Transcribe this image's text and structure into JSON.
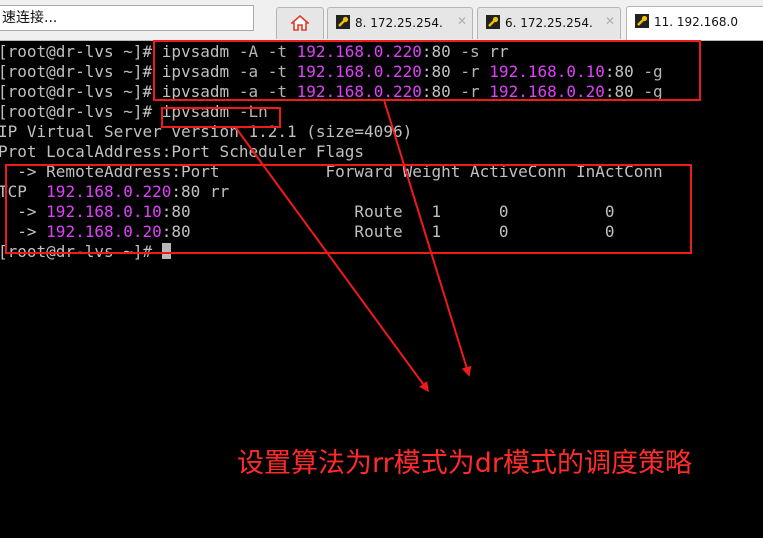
{
  "toolbar": {
    "quick_connect_text": "速连接..."
  },
  "tabs": [
    {
      "label": "",
      "icon": "home-icon",
      "active": false
    },
    {
      "label": "8. 172.25.254.",
      "icon": "tool-icon",
      "active": false
    },
    {
      "label": "6. 172.25.254.",
      "icon": "tool-icon",
      "active": false
    },
    {
      "label": "11. 192.168.0",
      "icon": "tool-icon",
      "active": true
    }
  ],
  "terminal": {
    "prompt": "[root@dr-lvs ~]#",
    "lines": [
      {
        "prompt": "[root@dr-lvs ~]#",
        "parts": [
          " ipvsadm ",
          "-A -t ",
          "192.168.0.220",
          ":80 ",
          "-s",
          " rr"
        ]
      },
      {
        "prompt": "[root@dr-lvs ~]#",
        "parts": [
          " ipvsadm ",
          "-a -t ",
          "192.168.0.220",
          ":80 ",
          "-r ",
          "192.168.0.10",
          ":80 ",
          "-g"
        ]
      },
      {
        "prompt": "[root@dr-lvs ~]#",
        "parts": [
          " ipvsadm ",
          "-a -t ",
          "192.168.0.220",
          ":80 ",
          "-r ",
          "192.168.0.20",
          ":80 ",
          "-g"
        ]
      },
      {
        "prompt": "[root@dr-lvs ~]#",
        "parts": [
          " ipvsadm ",
          "-Ln"
        ]
      },
      {
        "text": "IP Virtual Server version 1.2.1 (size=4096)"
      },
      {
        "text": "Prot LocalAddress:Port Scheduler Flags"
      },
      {
        "text": "  -> RemoteAddress:Port           Forward Weight ActiveConn InActConn"
      },
      {
        "parts": [
          "TCP  ",
          "192.168.0.220",
          ":80 rr"
        ]
      },
      {
        "parts": [
          "  -> ",
          "192.168.0.10",
          ":80",
          "                 Route   1      0          0"
        ]
      },
      {
        "parts": [
          "  -> ",
          "192.168.0.20",
          ":80",
          "                 Route   1      0          0"
        ]
      },
      {
        "prompt": "[root@dr-lvs ~]#",
        "parts": [
          " "
        ]
      }
    ]
  },
  "annotation": {
    "text": "设置算法为rr模式为dr模式的调度策略",
    "color": "#ff2a2a"
  },
  "colors": {
    "background": "#000000",
    "foreground": "#c0c0c0",
    "ip_highlight": "#e040fb",
    "annotation_red": "#ef1a1a"
  }
}
